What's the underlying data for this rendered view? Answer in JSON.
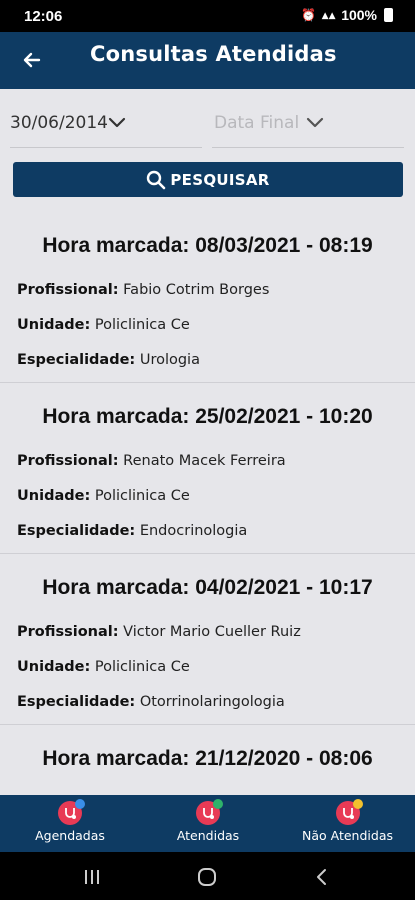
{
  "status_bar": {
    "time": "12:06",
    "battery": "100%"
  },
  "app_bar": {
    "title": "Consultas Atendidas"
  },
  "filters": {
    "start_date": "30/06/2014",
    "end_date_placeholder": "Data Final",
    "search_label": "PESQUISAR"
  },
  "labels": {
    "profissional": "Profissional:",
    "unidade": "Unidade:",
    "especialidade": "Especialidade:"
  },
  "appointments": [
    {
      "title": "Hora marcada: 08/03/2021 - 08:19",
      "profissional": "Fabio Cotrim Borges",
      "unidade": "Policlinica Ce",
      "especialidade": "Urologia"
    },
    {
      "title": "Hora marcada: 25/02/2021 - 10:20",
      "profissional": "Renato Macek Ferreira",
      "unidade": "Policlinica Ce",
      "especialidade": "Endocrinologia"
    },
    {
      "title": "Hora marcada: 04/02/2021 - 10:17",
      "profissional": "Victor Mario Cueller Ruiz",
      "unidade": "Policlinica Ce",
      "especialidade": "Otorrinolaringologia"
    },
    {
      "title": "Hora marcada: 21/12/2020 - 08:06"
    }
  ],
  "bottom_nav": [
    {
      "label": "Agendadas",
      "icon": "stethoscope-icon",
      "badge_color": "#3a8ee8"
    },
    {
      "label": "Atendidas",
      "icon": "stethoscope-icon",
      "badge_color": "#2fb36a"
    },
    {
      "label": "Não Atendidas",
      "icon": "stethoscope-icon",
      "badge_color": "#f2c12e"
    }
  ],
  "colors": {
    "primary": "#0e3b63",
    "accent": "#e83a55",
    "background": "#e6e6ea"
  }
}
